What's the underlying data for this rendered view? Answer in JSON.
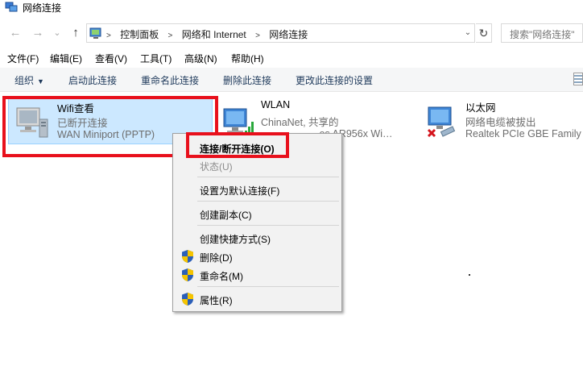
{
  "window": {
    "title": "网络连接"
  },
  "nav": {
    "back": "←",
    "forward": "→",
    "recent": "⌄",
    "up": "↑"
  },
  "address": {
    "crumbs": [
      "控制面板",
      "网络和 Internet",
      "网络连接"
    ],
    "dropdown": "⌄",
    "refresh": "↻"
  },
  "search": {
    "placeholder": "搜索\"网络连接\""
  },
  "menubar": [
    "文件(F)",
    "编辑(E)",
    "查看(V)",
    "工具(T)",
    "高级(N)",
    "帮助(H)"
  ],
  "commandbar": {
    "organize": "组织",
    "organize_caret": "▼",
    "start": "启动此连接",
    "rename": "重命名此连接",
    "delete": "删除此连接",
    "change": "更改此连接的设置"
  },
  "connections": [
    {
      "name": "Wifi查看",
      "status": "已断开连接",
      "device": "WAN Miniport (PPTP)",
      "selected": true
    },
    {
      "name": "WLAN",
      "status": "ChinaNet, 共享的",
      "device": "…os AR956x Wi…",
      "selected": false
    },
    {
      "name": "以太网",
      "status": "网络电缆被拔出",
      "device": "Realtek PCIe GBE Family C",
      "selected": false
    }
  ],
  "context_menu": {
    "connect": "连接/断开连接(O)",
    "status": "状态(U)",
    "set_default": "设置为默认连接(F)",
    "copy": "创建副本(C)",
    "shortcut": "创建快捷方式(S)",
    "delete": "删除(D)",
    "rename": "重命名(M)",
    "properties": "属性(R)"
  },
  "colors": {
    "selection": "#cce8ff",
    "highlight": "#e8101c",
    "shield_blue": "#2b5fb8",
    "shield_yellow": "#f5c400"
  }
}
